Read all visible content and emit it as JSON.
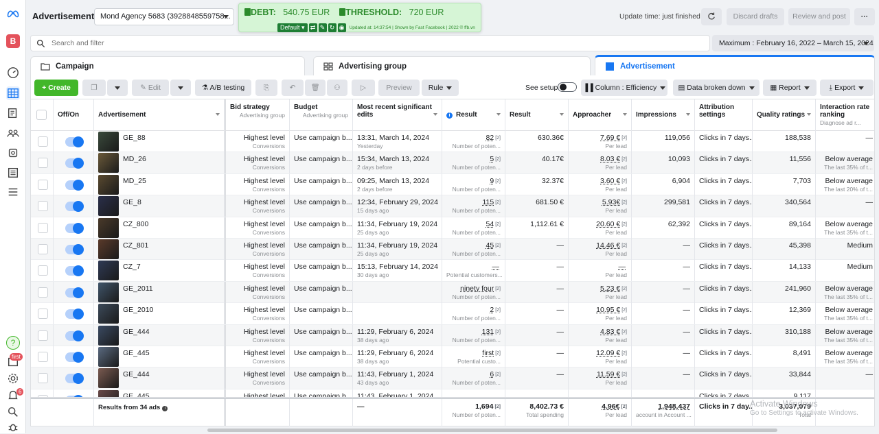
{
  "rail": {
    "avatar_letter": "B",
    "notif_badge_first": "first",
    "notif_badge_count": "6",
    "help_glyph": "?"
  },
  "header": {
    "title": "Advertisement",
    "account_select": "Mond Agency 5683 (3928848559758...",
    "update_time": "Update time: just finished",
    "discard_drafts": "Discard drafts",
    "review_post": "Review and post",
    "more": "···"
  },
  "debt_widget": {
    "debt_label": "DEBT:",
    "debt_value": "540.75 EUR",
    "threshold_label": "THRESHOLD:",
    "threshold_value": "720 EUR",
    "preset": "Default",
    "note": "Updated at: 14:37:54 | Shown by Fast Facebook | 2022 © ffb.vn"
  },
  "search": {
    "placeholder": "Search and filter"
  },
  "date_range": "Maximum : February 16, 2022 – March 15, 2024",
  "tabs": [
    {
      "label": "Campaign"
    },
    {
      "label": "Advertising group"
    },
    {
      "label": "Advertisement"
    }
  ],
  "toolbar": {
    "create": "Create",
    "edit": "Edit",
    "ab_testing": "A/B testing",
    "preview": "Preview",
    "rule": "Rule",
    "see_setup": "See setup",
    "column": "Column : Efficiency",
    "breakdown": "Data broken down",
    "report": "Report",
    "export": "Export"
  },
  "columns": {
    "onoff": "Off/On",
    "ad": "Advertisement",
    "bid": "Bid strategy",
    "bid_sub": "Advertising group",
    "budget": "Budget",
    "budget_sub": "Advertising group",
    "edits": "Most recent significant edits",
    "result1": "Result",
    "result2": "Result",
    "approacher": "Approacher",
    "impressions": "Impressions",
    "attribution": "Attribution settings",
    "quality": "Quality ratings",
    "interaction": "Interaction rate ranking",
    "interaction_sub": "Diagnose ad r..."
  },
  "thumb_colors": [
    "#3a4a3c",
    "#6b5a3a",
    "#5a4a30",
    "#2a2f4a",
    "#4a3a2a",
    "#5a3a2a",
    "#2f3a55",
    "#40556a",
    "#3c4a5a",
    "#3a4a62",
    "#5a6a80",
    "#7a5a50",
    "#6a4a48"
  ],
  "rows": [
    {
      "name": "GE_88",
      "bid": "Highest level",
      "bid_sub": "Conversions",
      "budget": "Use campaign b...",
      "edit": "13:31, March 14, 2024",
      "edit_sub": "Yesterday",
      "res": "82",
      "res_sup": "[2]",
      "res_sub": "Number of poten...",
      "cost": "630.36€",
      "appr": "7.69 €",
      "appr_sup": "[2]",
      "appr_sub": "Per lead",
      "impr": "119,056",
      "attr": "Clicks in 7 days...",
      "qual": "188,538",
      "inter": "—",
      "inter_sub": ""
    },
    {
      "name": "MD_26",
      "bid": "Highest level",
      "bid_sub": "Conversions",
      "budget": "Use campaign b...",
      "edit": "15:34, March 13, 2024",
      "edit_sub": "2 days before",
      "res": "5",
      "res_sup": "[2]",
      "res_sub": "Number of poten...",
      "cost": "40.17€",
      "appr": "8.03 €",
      "appr_sup": "[2]",
      "appr_sub": "Per lead",
      "impr": "10,093",
      "attr": "Clicks in 7 days...",
      "qual": "11,556",
      "inter": "Below average",
      "inter_sub": "The last 35% of t..."
    },
    {
      "name": "MD_25",
      "bid": "Highest level",
      "bid_sub": "Conversions",
      "budget": "Use campaign b...",
      "edit": "09:25, March 13, 2024",
      "edit_sub": "2 days before",
      "res": "9",
      "res_sup": "[2]",
      "res_sub": "Number of poten...",
      "cost": "32.37€",
      "appr": "3.60 €",
      "appr_sup": "[2]",
      "appr_sub": "Per lead",
      "impr": "6,904",
      "attr": "Clicks in 7 days...",
      "qual": "7,703",
      "inter": "Below average",
      "inter_sub": "The last 20% of t..."
    },
    {
      "name": "GE_8",
      "bid": "Highest level",
      "bid_sub": "Conversions",
      "budget": "Use campaign b...",
      "edit": "12:34, February 29, 2024",
      "edit_sub": "15 days ago",
      "res": "115",
      "res_sup": "[2]",
      "res_sub": "Number of poten...",
      "cost": "681.50 €",
      "appr": "5.93€",
      "appr_sup": "[2]",
      "appr_sub": "Per lead",
      "impr": "299,581",
      "attr": "Clicks in 7 days...",
      "qual": "340,564",
      "inter": "—",
      "inter_sub": ""
    },
    {
      "name": "CZ_800",
      "bid": "Highest level",
      "bid_sub": "Conversions",
      "budget": "Use campaign b...",
      "edit": "11:34, February 19, 2024",
      "edit_sub": "25 days ago",
      "res": "54",
      "res_sup": "[2]",
      "res_sub": "Number of poten...",
      "cost": "1,112.61 €",
      "appr": "20.60 €",
      "appr_sup": "[2]",
      "appr_sub": "Per lead",
      "impr": "62,392",
      "attr": "Clicks in 7 days...",
      "qual": "89,164",
      "inter": "Below average",
      "inter_sub": "The last 35% of t..."
    },
    {
      "name": "CZ_801",
      "bid": "Highest level",
      "bid_sub": "Conversions",
      "budget": "Use campaign b...",
      "edit": "11:34, February 19, 2024",
      "edit_sub": "25 days ago",
      "res": "45",
      "res_sup": "[2]",
      "res_sub": "Number of poten...",
      "cost": "—",
      "appr": "14.46 €",
      "appr_sup": "[2]",
      "appr_sub": "Per lead",
      "impr": "—",
      "attr": "Clicks in 7 days...",
      "qual": "45,398",
      "inter": "Medium",
      "inter_sub": ""
    },
    {
      "name": "CZ_7",
      "bid": "Highest level",
      "bid_sub": "Conversions",
      "budget": "Use campaign b...",
      "edit": "15:13, February 14, 2024",
      "edit_sub": "30 days ago",
      "res": "—",
      "res_sup": "",
      "res_sub": "Potential customers...",
      "cost": "—",
      "appr": "—",
      "appr_sup": "",
      "appr_sub": "Per lead",
      "impr": "—",
      "attr": "Clicks in 7 days...",
      "qual": "14,133",
      "inter": "Medium",
      "inter_sub": ""
    },
    {
      "name": "GE_2011",
      "bid": "Highest level",
      "bid_sub": "Conversions",
      "budget": "Use campaign b...",
      "edit": "",
      "edit_sub": "",
      "res": "ninety four",
      "res_sup": "[2]",
      "res_sub": "Number of poten...",
      "cost": "—",
      "appr": "5.23 €",
      "appr_sup": "[2]",
      "appr_sub": "Per lead",
      "impr": "—",
      "attr": "Clicks in 7 days...",
      "qual": "241,960",
      "inter": "Below average",
      "inter_sub": "The last 35% of t..."
    },
    {
      "name": "GE_2010",
      "bid": "Highest level",
      "bid_sub": "Conversions",
      "budget": "Use campaign b...",
      "edit": "",
      "edit_sub": "",
      "res": "2",
      "res_sup": "[2]",
      "res_sub": "Number of poten...",
      "cost": "—",
      "appr": "10.95 €",
      "appr_sup": "[2]",
      "appr_sub": "Per lead",
      "impr": "—",
      "attr": "Clicks in 7 days...",
      "qual": "12,369",
      "inter": "Below average",
      "inter_sub": "The last 35% of t..."
    },
    {
      "name": "GE_444",
      "bid": "Highest level",
      "bid_sub": "Conversions",
      "budget": "Use campaign b...",
      "edit": "11:29, February 6, 2024",
      "edit_sub": "38 days ago",
      "res": "131",
      "res_sup": "[2]",
      "res_sub": "Number of poten...",
      "cost": "—",
      "appr": "4.83 €",
      "appr_sup": "[2]",
      "appr_sub": "Per lead",
      "impr": "—",
      "attr": "Clicks in 7 days...",
      "qual": "310,188",
      "inter": "Below average",
      "inter_sub": "The last 35% of t..."
    },
    {
      "name": "GE_445",
      "bid": "Highest level",
      "bid_sub": "Conversions",
      "budget": "Use campaign b...",
      "edit": "11:29, February 6, 2024",
      "edit_sub": "38 days ago",
      "res": "first",
      "res_sup": "[2]",
      "res_sub": "Potential custo...",
      "cost": "—",
      "appr": "12.09 €",
      "appr_sup": "[2]",
      "appr_sub": "Per lead",
      "impr": "—",
      "attr": "Clicks in 7 days...",
      "qual": "8,491",
      "inter": "Below average",
      "inter_sub": "The last 35% of t..."
    },
    {
      "name": "GE_444",
      "bid": "Highest level",
      "bid_sub": "Conversions",
      "budget": "Use campaign b...",
      "edit": "11:43, February 1, 2024",
      "edit_sub": "43 days ago",
      "res": "6",
      "res_sup": "[2]",
      "res_sub": "Number of poten...",
      "cost": "—",
      "appr": "11.59 €",
      "appr_sup": "[2]",
      "appr_sub": "Per lead",
      "impr": "—",
      "attr": "Clicks in 7 days...",
      "qual": "33,844",
      "inter": "—",
      "inter_sub": ""
    },
    {
      "name": "GE_445",
      "bid": "Highest level",
      "bid_sub": "Conversions",
      "budget": "Use campaign b...",
      "edit": "11:43, February 1, 2024",
      "edit_sub": "",
      "res": "",
      "res_sup": "",
      "res_sub": "",
      "cost": "",
      "appr": "",
      "appr_sup": "",
      "appr_sub": "",
      "impr": "",
      "attr": "Clicks in 7 days...",
      "qual": "9,117",
      "inter": "",
      "inter_sub": ""
    }
  ],
  "totals": {
    "label": "Results from 34 ads",
    "edits": "—",
    "res": "1,694",
    "res_sup": "[2]",
    "res_sub": "Number of poten...",
    "cost": "8,402.73 €",
    "cost_sub": "Total spending",
    "appr": "4.96€",
    "appr_sup": "[2]",
    "appr_sub": "Per lead",
    "impr": "1,948,437",
    "impr_sub": "account in Account ...",
    "attr": "Clicks in 7 day...",
    "qual": "3,037,079",
    "qual_sub": "Total"
  },
  "watermark": {
    "line1": "Activate Windows",
    "line2": "Go to Settings to activate Windows."
  }
}
